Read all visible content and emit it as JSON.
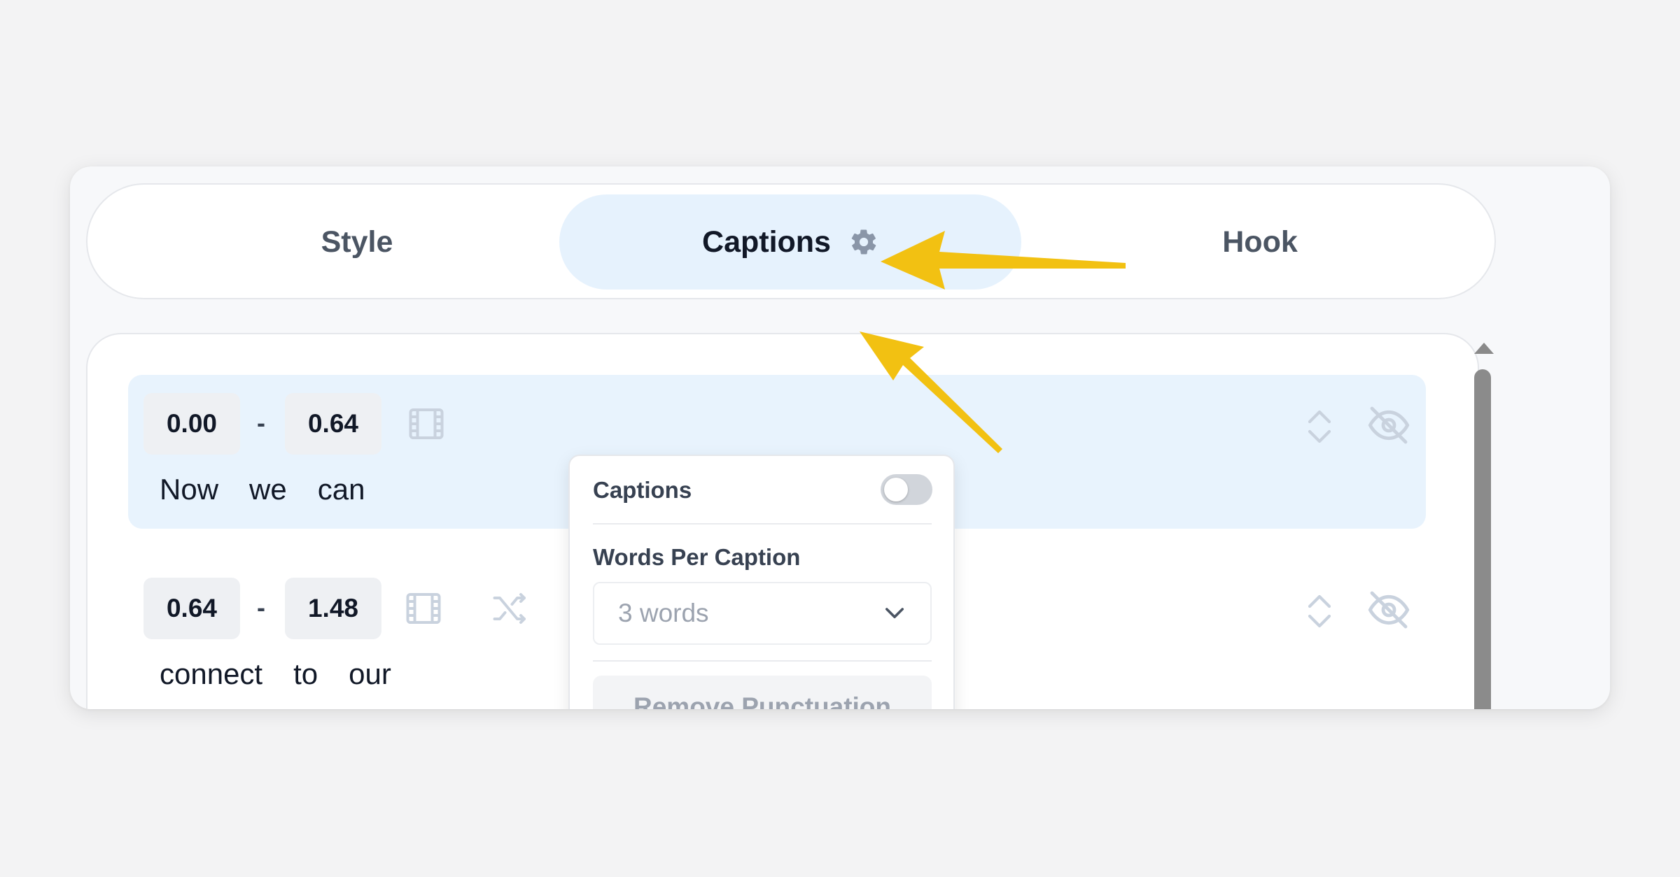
{
  "tabs": [
    {
      "label": "Style",
      "active": false
    },
    {
      "label": "Captions",
      "active": true,
      "icon": "gear-icon"
    },
    {
      "label": "Hook",
      "active": false
    }
  ],
  "rows": [
    {
      "start": "0.00",
      "separator": "-",
      "end": "0.64",
      "words": [
        "Now",
        "we",
        "can"
      ],
      "highlighted": true
    },
    {
      "start": "0.64",
      "separator": "-",
      "end": "1.48",
      "words": [
        "connect",
        "to",
        "our"
      ],
      "highlighted": false
    }
  ],
  "popover": {
    "captions_label": "Captions",
    "captions_enabled": false,
    "words_per_caption_label": "Words Per Caption",
    "words_per_caption_value": "3 words",
    "remove_punctuation_label": "Remove Punctuation"
  },
  "colors": {
    "active_tab_bg": "#e6f2fd",
    "row_highlight": "#e8f3fd",
    "annotation_arrow": "#f2c112",
    "icon_muted": "#c9d2de"
  }
}
